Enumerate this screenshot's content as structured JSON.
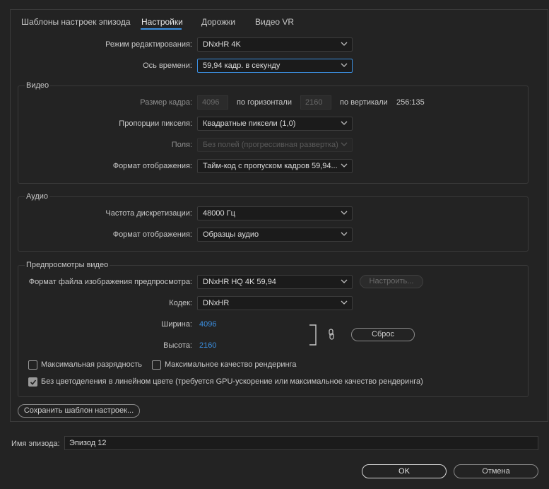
{
  "tabs": [
    {
      "label": "Шаблоны настроек эпизода",
      "active": false
    },
    {
      "label": "Настройки",
      "active": true
    },
    {
      "label": "Дорожки",
      "active": false
    },
    {
      "label": "Видео VR",
      "active": false
    }
  ],
  "settings": {
    "editing_mode_label": "Режим редактирования:",
    "editing_mode_value": "DNxHR 4K",
    "timebase_label": "Ось времени:",
    "timebase_value": "59,94  кадр. в секунду"
  },
  "video": {
    "title": "Видео",
    "frame_size_label": "Размер кадра:",
    "frame_width": "4096",
    "horizontal_label": "по горизонтали",
    "frame_height": "2160",
    "vertical_label": "по вертикали",
    "aspect": "256:135",
    "pixel_aspect_label": "Пропорции пикселя:",
    "pixel_aspect_value": "Квадратные пиксели (1,0)",
    "fields_label": "Поля:",
    "fields_value": "Без полей (прогрессивная развертка)",
    "display_format_label": "Формат отображения:",
    "display_format_value": "Тайм-код с пропуском кадров 59,94..."
  },
  "audio": {
    "title": "Аудио",
    "sample_rate_label": "Частота дискретизации:",
    "sample_rate_value": "48000 Гц",
    "display_format_label": "Формат отображения:",
    "display_format_value": "Образцы аудио"
  },
  "previews": {
    "title": "Предпросмотры видео",
    "file_format_label": "Формат файла изображения предпросмотра:",
    "file_format_value": "DNxHR HQ 4K 59,94",
    "configure_label": "Настроить...",
    "codec_label": "Кодек:",
    "codec_value": "DNxHR",
    "width_label": "Ширина:",
    "width_value": "4096",
    "height_label": "Высота:",
    "height_value": "2160",
    "reset_label": "Сброс",
    "max_bit_depth_label": "Максимальная разрядность",
    "max_bit_depth_checked": false,
    "max_render_quality_label": "Максимальное качество рендеринга",
    "max_render_quality_checked": false,
    "linear_color_label": "Без цветоделения в линейном цвете (требуется GPU-ускорение или максимальное качество рендеринга)",
    "linear_color_checked": true
  },
  "save_preset_label": "Сохранить шаблон настроек...",
  "sequence_name_label": "Имя эпизода:",
  "sequence_name_value": "Эпизод 12",
  "ok_label": "OK",
  "cancel_label": "Отмена",
  "colors": {
    "accent": "#3b8fe0",
    "background": "#232323"
  }
}
